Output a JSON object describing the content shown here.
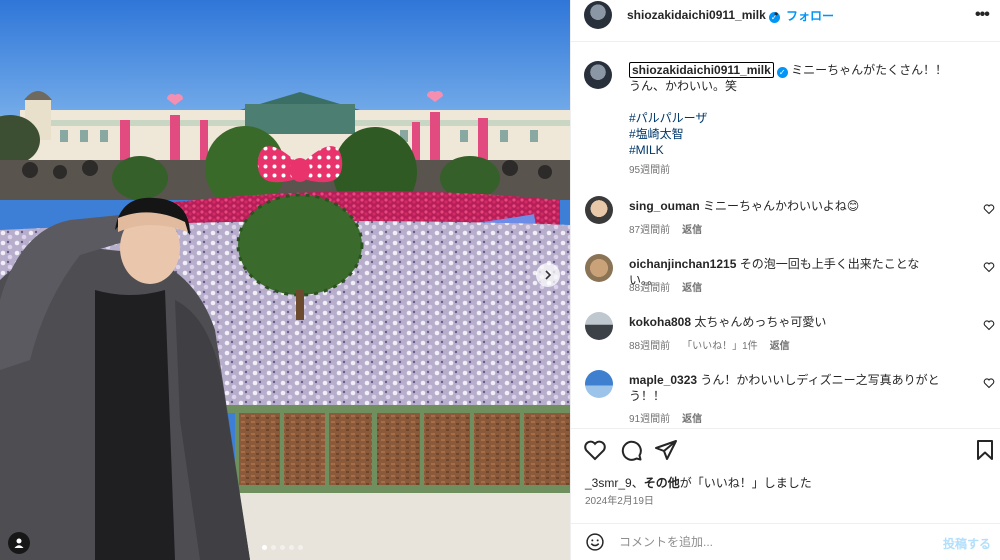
{
  "post": {
    "username": "shiozakidaichi0911_milk",
    "verified": true,
    "follow_label": "フォロー",
    "separator": "•",
    "more_label": "•••",
    "caption_line1": "ミニーちゃんがたくさん！！",
    "caption_line2": "うん、かわいい。笑",
    "hashtags": [
      "#パルパルーザ",
      "#塩崎太智",
      "#MILK"
    ],
    "caption_time": "95週間前"
  },
  "comments": [
    {
      "user": "sing_ouman",
      "text": "ミニーちゃんかわいいよね😊",
      "time": "87週間前",
      "likes": "",
      "reply": "返信"
    },
    {
      "user": "oichanjinchan1215",
      "text": "その泡一回も上手く出来たことない。。",
      "time": "88週間前",
      "likes": "",
      "reply": "返信"
    },
    {
      "user": "kokoha808",
      "text": "太ちゃんめっちゃ可愛い",
      "time": "88週間前",
      "likes": "「いいね！」1件",
      "reply": "返信"
    },
    {
      "user": "maple_0323",
      "text": "うん！かわいいしディズニー之写真ありがとう！！",
      "time": "91週間前",
      "likes": "",
      "reply": "返信"
    }
  ],
  "likes_line": {
    "users": "_3smr_9、",
    "others": "その他",
    "suffix": "が「いいね！」しました"
  },
  "date": "2024年2月19日",
  "comment_input": {
    "placeholder": "コメントを追加...",
    "post_label": "投稿する"
  },
  "carousel": {
    "total": 5,
    "current": 1
  },
  "colors": {
    "accent": "#0095f6",
    "link": "#00376b",
    "minnie_bow": "#e8336d"
  }
}
